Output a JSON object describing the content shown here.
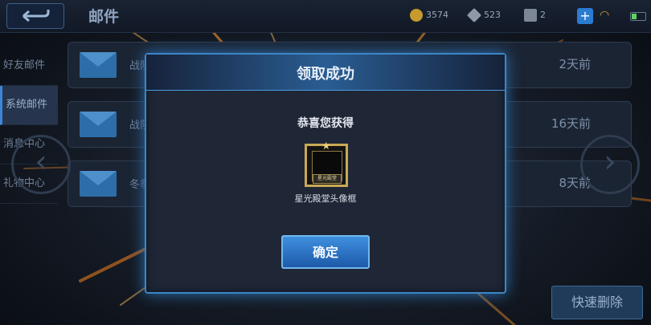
{
  "header": {
    "title": "邮件",
    "gold": "3574",
    "diamonds": "523",
    "vouchers": "2",
    "plus_label": "+"
  },
  "sidebar": {
    "items": [
      {
        "label": "好友邮件"
      },
      {
        "label": "系统邮件"
      },
      {
        "label": "消息中心"
      },
      {
        "label": "礼物中心"
      }
    ]
  },
  "mails": [
    {
      "subject": "战队",
      "time": "2天前"
    },
    {
      "subject": "战队",
      "time": "16天前"
    },
    {
      "subject": "冬季",
      "time": "8天前"
    }
  ],
  "nav": {
    "left_arrow": "‹",
    "right_arrow": "›"
  },
  "quick_delete_label": "快速删除",
  "dialog": {
    "title": "领取成功",
    "congrats": "恭喜您获得",
    "reward": {
      "name": "星光殿堂头像框",
      "plate": "星光殿堂"
    },
    "confirm_label": "确定"
  },
  "colors": {
    "accent": "#3b86d6",
    "gold": "#c9a955",
    "warn": "#e07a1f"
  }
}
